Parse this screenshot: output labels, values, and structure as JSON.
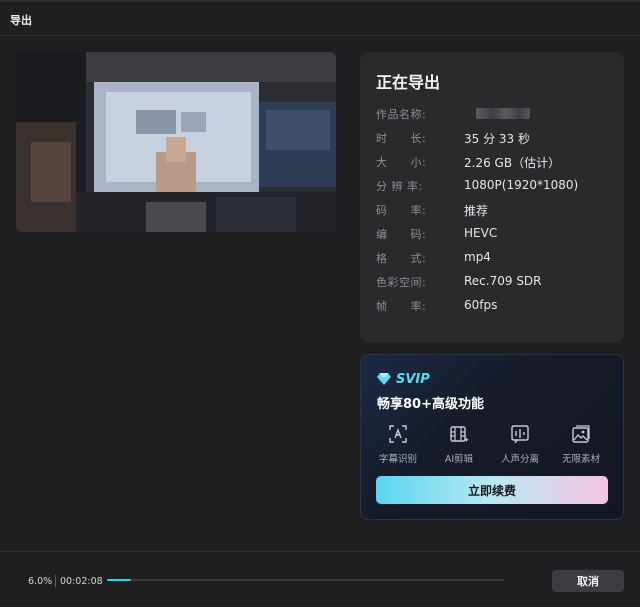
{
  "window": {
    "title": "导出"
  },
  "info": {
    "heading": "正在导出",
    "rows": [
      {
        "label": "作品名称:",
        "value": ""
      },
      {
        "label": "时　　长:",
        "value": "35 分 33 秒"
      },
      {
        "label": "大　　小:",
        "value": "2.26 GB（估计）"
      },
      {
        "label": "分 辨 率:",
        "value": "1080P(1920*1080)"
      },
      {
        "label": "码　　率:",
        "value": "推荐"
      },
      {
        "label": "编　　码:",
        "value": "HEVC"
      },
      {
        "label": "格　　式:",
        "value": "mp4"
      },
      {
        "label": "色彩空间:",
        "value": "Rec.709 SDR"
      },
      {
        "label": "帧　　率:",
        "value": "60fps"
      }
    ]
  },
  "svip": {
    "badge": "SVIP",
    "tagline": "畅享80+高级功能",
    "features": [
      {
        "label": "字幕识别",
        "icon": "subtitle-recognition-icon"
      },
      {
        "label": "AI剪辑",
        "icon": "ai-edit-icon"
      },
      {
        "label": "人声分离",
        "icon": "voice-separation-icon"
      },
      {
        "label": "无限素材",
        "icon": "unlimited-assets-icon"
      }
    ],
    "button_label": "立即续费",
    "colors": {
      "accent": "#5fd9f0",
      "gradient_start": "#5ad5ef",
      "gradient_end": "#f5c4e2"
    }
  },
  "progress": {
    "percent_label": "6.0%",
    "percent": 6.0,
    "elapsed": "00:02:08",
    "fill_color": "#2ad4e6"
  },
  "actions": {
    "cancel_label": "取消"
  }
}
